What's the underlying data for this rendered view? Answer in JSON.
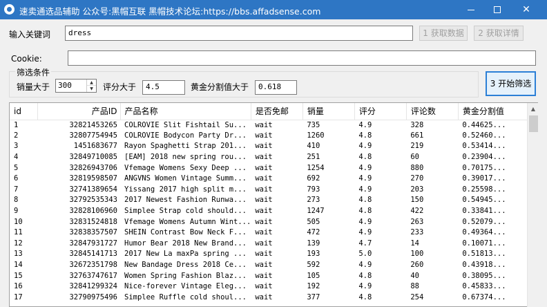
{
  "window": {
    "title": "速卖通选品辅助  公众号:黑帽互联   黑帽技术论坛:https://bbs.affadsense.com"
  },
  "search": {
    "keyword_label": "输入关键词",
    "keyword_value": "dress",
    "fetch_data_label": "1 获取数据",
    "fetch_detail_label": "2 获取详情"
  },
  "cookie": {
    "label": "Cookie:",
    "value": ""
  },
  "filters": {
    "group_label": "筛选条件",
    "sales_label": "销量大于",
    "sales_value": "300",
    "rating_label": "评分大于",
    "rating_value": "4.5",
    "golden_label": "黄金分割值大于",
    "golden_value": "0.618",
    "start_label": "3 开始筛选"
  },
  "table": {
    "columns": [
      "id",
      "产品ID",
      "产品名称",
      "是否免邮",
      "销量",
      "评分",
      "评论数",
      "黄金分割值"
    ],
    "rows": [
      [
        "1",
        "32821453265",
        "COLROVIE Slit Fishtail Su...",
        "wait",
        "735",
        "4.9",
        "328",
        "0.44625..."
      ],
      [
        "2",
        "32807754945",
        "COLROVIE Bodycon Party Dr...",
        "wait",
        "1260",
        "4.8",
        "661",
        "0.52460..."
      ],
      [
        "3",
        "1451683677",
        "Rayon Spaghetti Strap 201...",
        "wait",
        "410",
        "4.9",
        "219",
        "0.53414..."
      ],
      [
        "4",
        "32849710085",
        "[EAM] 2018 new spring rou...",
        "wait",
        "251",
        "4.8",
        "60",
        "0.23904..."
      ],
      [
        "5",
        "32826943706",
        "Vfemage Womens Sexy Deep ...",
        "wait",
        "1254",
        "4.9",
        "880",
        "0.70175..."
      ],
      [
        "6",
        "32819598507",
        "ANGVNS Women Vintage Summ...",
        "wait",
        "692",
        "4.9",
        "270",
        "0.39017..."
      ],
      [
        "7",
        "32741389654",
        "Yissang 2017 high split m...",
        "wait",
        "793",
        "4.9",
        "203",
        "0.25598..."
      ],
      [
        "8",
        "32792535343",
        "2017 Newest Fashion Runwa...",
        "wait",
        "273",
        "4.8",
        "150",
        "0.54945..."
      ],
      [
        "9",
        "32828106960",
        "Simplee Strap cold should...",
        "wait",
        "1247",
        "4.8",
        "422",
        "0.33841..."
      ],
      [
        "10",
        "32831524818",
        "Vfemage Womens Autumn Wint...",
        "wait",
        "505",
        "4.9",
        "263",
        "0.52079..."
      ],
      [
        "11",
        "32838357507",
        "SHEIN Contrast Bow Neck F...",
        "wait",
        "472",
        "4.9",
        "233",
        "0.49364..."
      ],
      [
        "12",
        "32847931727",
        "Humor Bear 2018 New Brand...",
        "wait",
        "139",
        "4.7",
        "14",
        "0.10071..."
      ],
      [
        "13",
        "32845141713",
        "2017 New La maxPa spring ...",
        "wait",
        "193",
        "5.0",
        "100",
        "0.51813..."
      ],
      [
        "14",
        "32672351798",
        "New Bandage Dress 2018 Ce...",
        "wait",
        "592",
        "4.9",
        "260",
        "0.43918..."
      ],
      [
        "15",
        "32763747617",
        "Women Spring Fashion Blaz...",
        "wait",
        "105",
        "4.8",
        "40",
        "0.38095..."
      ],
      [
        "16",
        "32841299324",
        "Nice-forever Vintage Eleg...",
        "wait",
        "192",
        "4.9",
        "88",
        "0.45833..."
      ],
      [
        "17",
        "32790975496",
        "Simplee Ruffle cold shoul...",
        "wait",
        "377",
        "4.8",
        "254",
        "0.67374..."
      ]
    ]
  }
}
